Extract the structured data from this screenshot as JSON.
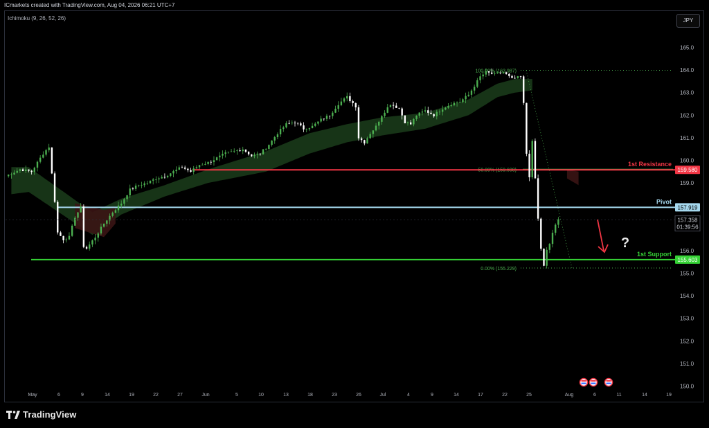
{
  "header": {
    "credit": "ICmarkets created with TradingView.com, Aug 04, 2026 06:21 UTC+7",
    "indicator": "Ichimoku (9, 26, 52, 26)",
    "currency": "JPY"
  },
  "footer": {
    "brand": "TradingView",
    "logo_icon": "tradingview-logo-icon"
  },
  "colors": {
    "background": "#000000",
    "candle_up": "#4caf50",
    "candle_down": "#ffffff",
    "resistance": "#f23645",
    "pivot": "#a5d8ee",
    "support": "#35d235",
    "fib": "#4caf50",
    "cloud_bull": "#1a3a1a",
    "cloud_bear": "#3a1414",
    "arrow": "#f23645"
  },
  "chart_data": {
    "type": "candlestick",
    "price_axis": {
      "ticks": [
        150,
        151,
        152,
        153,
        154,
        155,
        156,
        157,
        158,
        159,
        160,
        161,
        162,
        163,
        164,
        165
      ]
    },
    "time_axis": {
      "tick_labels": [
        "May",
        "6",
        "9",
        "14",
        "19",
        "22",
        "27",
        "Jun",
        "5",
        "10",
        "13",
        "18",
        "23",
        "26",
        "Jul",
        "4",
        "9",
        "14",
        "17",
        "22",
        "25",
        "Aug",
        "6",
        "11",
        "14",
        "19"
      ]
    },
    "price_path": [
      [
        0,
        159.3
      ],
      [
        5,
        159.6
      ],
      [
        9,
        159.5
      ],
      [
        13,
        160.3
      ],
      [
        15,
        160.6
      ],
      [
        17,
        158.2
      ],
      [
        18,
        156.8
      ],
      [
        20,
        156.5
      ],
      [
        22,
        156.6
      ],
      [
        24,
        157.5
      ],
      [
        26,
        157.9
      ],
      [
        27,
        156.2
      ],
      [
        28,
        156.1
      ],
      [
        31,
        156.6
      ],
      [
        34,
        157.2
      ],
      [
        37,
        157.7
      ],
      [
        40,
        158.1
      ],
      [
        43,
        158.7
      ],
      [
        46,
        158.9
      ],
      [
        49,
        159.0
      ],
      [
        52,
        159.2
      ],
      [
        55,
        159.3
      ],
      [
        58,
        159.5
      ],
      [
        61,
        159.7
      ],
      [
        64,
        159.5
      ],
      [
        67,
        159.8
      ],
      [
        70,
        159.9
      ],
      [
        73,
        160.1
      ],
      [
        76,
        160.3
      ],
      [
        79,
        160.4
      ],
      [
        82,
        160.5
      ],
      [
        85,
        160.2
      ],
      [
        88,
        160.3
      ],
      [
        91,
        160.7
      ],
      [
        94,
        161.2
      ],
      [
        97,
        161.6
      ],
      [
        100,
        161.7
      ],
      [
        103,
        161.4
      ],
      [
        106,
        161.5
      ],
      [
        109,
        161.8
      ],
      [
        112,
        162.0
      ],
      [
        115,
        162.5
      ],
      [
        118,
        162.8
      ],
      [
        121,
        162.4
      ],
      [
        122,
        161.0
      ],
      [
        124,
        160.8
      ],
      [
        126,
        161.2
      ],
      [
        128,
        161.5
      ],
      [
        130,
        162.0
      ],
      [
        133,
        162.5
      ],
      [
        136,
        162.3
      ],
      [
        138,
        161.7
      ],
      [
        140,
        161.6
      ],
      [
        142,
        162.0
      ],
      [
        145,
        162.2
      ],
      [
        148,
        162.0
      ],
      [
        151,
        162.3
      ],
      [
        154,
        162.5
      ],
      [
        157,
        162.6
      ],
      [
        160,
        162.9
      ],
      [
        162,
        163.3
      ],
      [
        164,
        163.7
      ],
      [
        166,
        163.9
      ],
      [
        169,
        163.8
      ],
      [
        172,
        163.9
      ],
      [
        175,
        163.6
      ],
      [
        178,
        163.7
      ],
      [
        179,
        162.5
      ],
      [
        180,
        160.3
      ],
      [
        181,
        159.3
      ],
      [
        182,
        160.8
      ],
      [
        183,
        159.2
      ],
      [
        184,
        157.4
      ],
      [
        185,
        156.1
      ],
      [
        186,
        155.3
      ],
      [
        187,
        156.0
      ],
      [
        188,
        156.3
      ],
      [
        189,
        156.8
      ],
      [
        190,
        157.1
      ],
      [
        191,
        157.36
      ]
    ],
    "cloud_bull": [
      [
        2,
        158.5,
        159.7
      ],
      [
        8,
        158.6,
        159.7
      ],
      [
        30,
        156.7,
        157.7
      ],
      [
        40,
        157.6,
        158.3
      ],
      [
        55,
        158.4,
        158.9
      ],
      [
        70,
        159.0,
        159.6
      ],
      [
        90,
        159.5,
        160.4
      ],
      [
        105,
        160.3,
        161.2
      ],
      [
        118,
        160.8,
        161.6
      ],
      [
        130,
        161.1,
        161.9
      ],
      [
        145,
        161.4,
        162.1
      ],
      [
        160,
        162.0,
        162.7
      ],
      [
        170,
        162.8,
        163.4
      ],
      [
        176,
        163.0,
        163.6
      ],
      [
        182,
        163.1,
        163.6
      ]
    ],
    "cloud_bear": [
      [
        24,
        157.0,
        158.1
      ],
      [
        34,
        156.6,
        157.8
      ],
      [
        38,
        157.2,
        157.9
      ]
    ],
    "cloud_bear_right": [
      [
        194,
        159.2,
        159.6
      ],
      [
        198,
        158.9,
        159.5
      ]
    ],
    "levels": [
      {
        "name": "1st Resistance",
        "price": 159.58,
        "label": "159.580",
        "color": "resistance"
      },
      {
        "name": "Pivot",
        "price": 157.919,
        "label": "157.919",
        "color": "pivot"
      },
      {
        "name": "1st Support",
        "price": 155.603,
        "label": "155.603",
        "color": "support"
      }
    ],
    "fib_levels": [
      {
        "label": "100.00% (163.987)",
        "price": 163.987
      },
      {
        "label": "50.00% (159.608)",
        "price": 159.608
      },
      {
        "label": "0.00% (155.229)",
        "price": 155.229
      }
    ],
    "current": {
      "price": "157.358",
      "countdown": "01:39:56",
      "value": 157.358
    },
    "question_mark": "?",
    "event_icons_count": 3
  }
}
